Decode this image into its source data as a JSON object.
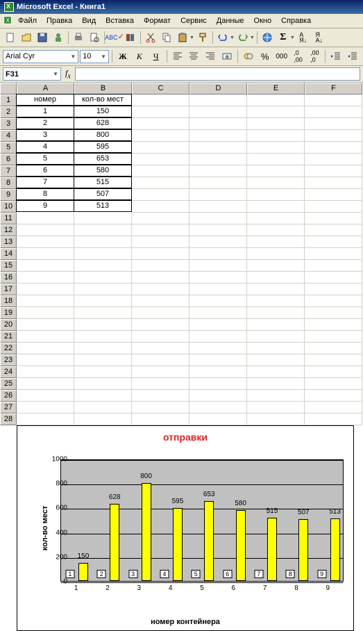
{
  "title": "Microsoft Excel - Книга1",
  "menu": {
    "file": "Файл",
    "edit": "Правка",
    "view": "Вид",
    "insert": "Вставка",
    "format": "Формат",
    "tools": "Сервис",
    "data": "Данные",
    "window": "Окно",
    "help": "Справка"
  },
  "format_bar": {
    "font": "Arial Cyr",
    "size": "10"
  },
  "namebox": "F31",
  "columns": [
    "A",
    "B",
    "C",
    "D",
    "E",
    "F"
  ],
  "rows": [
    "1",
    "2",
    "3",
    "4",
    "5",
    "6",
    "7",
    "8",
    "9",
    "10",
    "11",
    "12",
    "13",
    "14",
    "15",
    "16",
    "17",
    "18",
    "19",
    "20",
    "21",
    "22",
    "23",
    "24",
    "25",
    "26",
    "27",
    "28"
  ],
  "table": {
    "headers": {
      "A1": "номер контейнера",
      "B1": "кол-во мест"
    },
    "data": [
      {
        "num": "1",
        "val": "150"
      },
      {
        "num": "2",
        "val": "628"
      },
      {
        "num": "3",
        "val": "800"
      },
      {
        "num": "4",
        "val": "595"
      },
      {
        "num": "5",
        "val": "653"
      },
      {
        "num": "6",
        "val": "580"
      },
      {
        "num": "7",
        "val": "515"
      },
      {
        "num": "8",
        "val": "507"
      },
      {
        "num": "9",
        "val": "513"
      }
    ]
  },
  "chart_data": {
    "type": "bar",
    "title": "отправки",
    "xlabel": "номер контейнера",
    "ylabel": "кол-во мест",
    "categories": [
      "1",
      "2",
      "3",
      "4",
      "5",
      "6",
      "7",
      "8",
      "9"
    ],
    "values": [
      150,
      628,
      800,
      595,
      653,
      580,
      515,
      507,
      513
    ],
    "ylim": [
      0,
      1000
    ],
    "yticks": [
      0,
      200,
      400,
      600,
      800,
      1000
    ]
  }
}
